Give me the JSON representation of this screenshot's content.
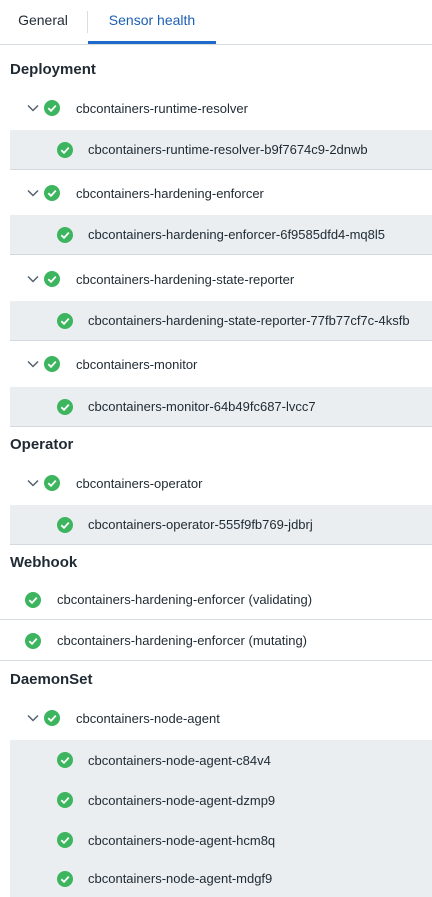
{
  "tabs": {
    "general": "General",
    "sensor_health": "Sensor health"
  },
  "sections": {
    "deployment": "Deployment",
    "operator": "Operator",
    "webhook": "Webhook",
    "daemonset": "DaemonSet"
  },
  "deployment": [
    {
      "name": "cbcontainers-runtime-resolver",
      "child": "cbcontainers-runtime-resolver-b9f7674c9-2dnwb"
    },
    {
      "name": "cbcontainers-hardening-enforcer",
      "child": "cbcontainers-hardening-enforcer-6f9585dfd4-mq8l5"
    },
    {
      "name": "cbcontainers-hardening-state-reporter",
      "child": "cbcontainers-hardening-state-reporter-77fb77cf7c-4ksfb"
    },
    {
      "name": "cbcontainers-monitor",
      "child": "cbcontainers-monitor-64b49fc687-lvcc7"
    }
  ],
  "operator": {
    "name": "cbcontainers-operator",
    "child": "cbcontainers-operator-555f9fb769-jdbrj"
  },
  "webhook": [
    "cbcontainers-hardening-enforcer (validating)",
    "cbcontainers-hardening-enforcer (mutating)"
  ],
  "daemonset": {
    "name": "cbcontainers-node-agent",
    "children": [
      "cbcontainers-node-agent-c84v4",
      "cbcontainers-node-agent-dzmp9",
      "cbcontainers-node-agent-hcm8q",
      "cbcontainers-node-agent-mdgf9"
    ]
  },
  "colors": {
    "accent": "#1d6ac9",
    "ok": "#3cb55e",
    "row_bg": "#eaeef1"
  }
}
